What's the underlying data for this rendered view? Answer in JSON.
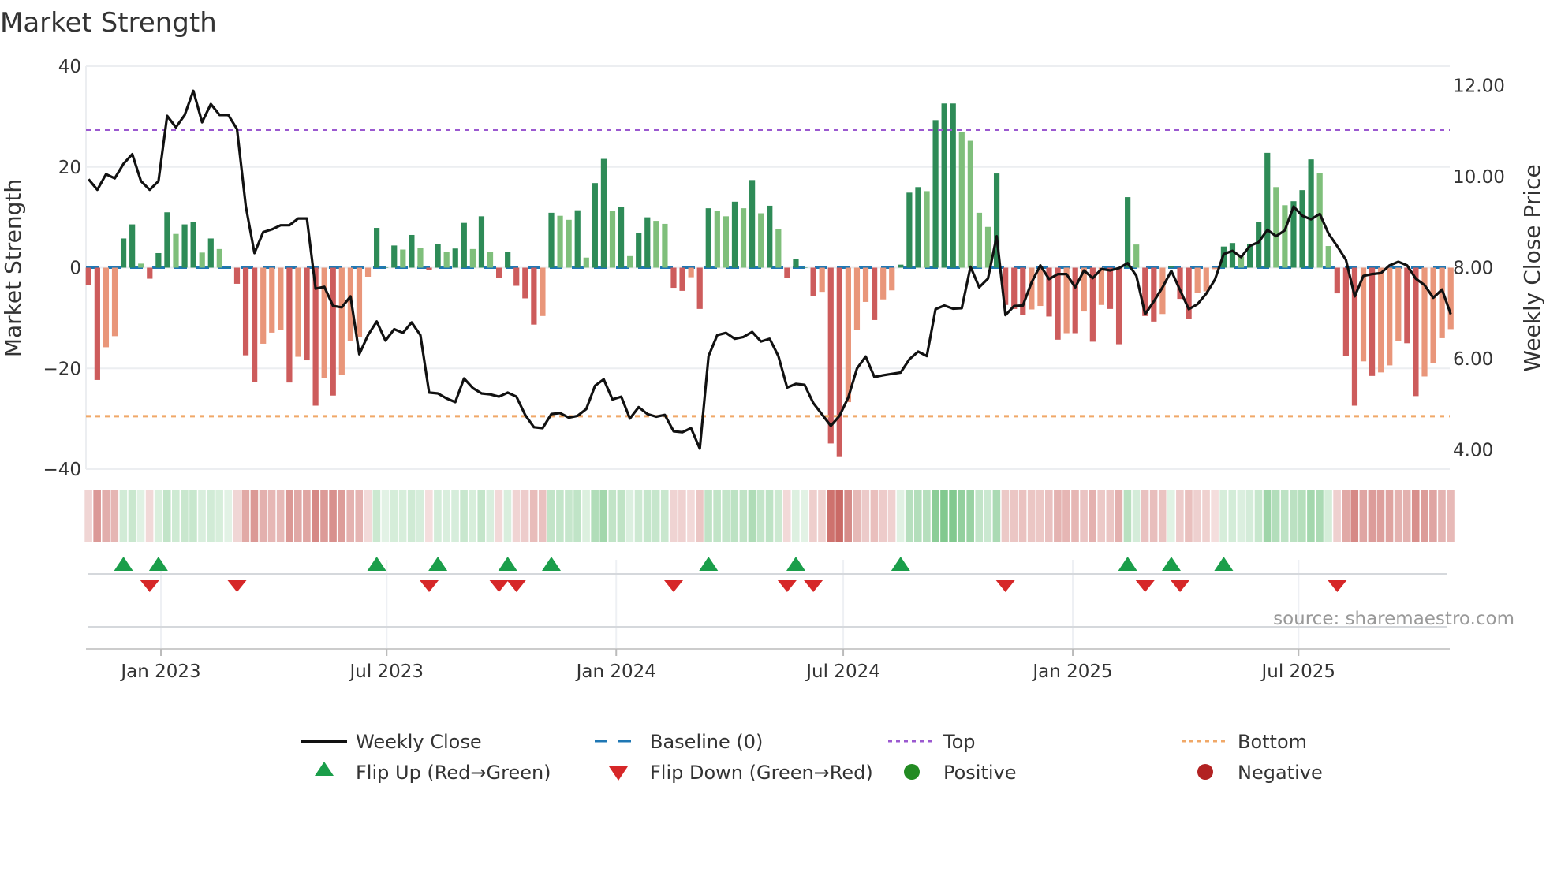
{
  "chart_data": {
    "type": "bar",
    "title": "Market Strength",
    "ylabel": "Market Strength",
    "y2label": "Weekly Close Price",
    "ylim": [
      -40,
      40
    ],
    "y2lim": [
      3.58,
      12.42
    ],
    "yticks": [
      "40",
      "20",
      "0",
      "−20",
      "−40"
    ],
    "ytick_values": [
      40,
      20,
      0,
      -20,
      -40
    ],
    "y2ticks": [
      "12.00",
      "10.00",
      "8.00",
      "6.00",
      "4.00"
    ],
    "y2tick_values": [
      12,
      10,
      8,
      6,
      4
    ],
    "xticks": [
      {
        "label": "Jan 2023",
        "date": "2023-01-01"
      },
      {
        "label": "Jul 2023",
        "date": "2023-07-01"
      },
      {
        "label": "Jan 2024",
        "date": "2024-01-01"
      },
      {
        "label": "Jul 2024",
        "date": "2024-07-01"
      },
      {
        "label": "Jan 2025",
        "date": "2025-01-01"
      },
      {
        "label": "Jul 2025",
        "date": "2025-07-01"
      }
    ],
    "first_week": "2022-11-04",
    "top_level": 27.4,
    "bottom_level": -29.5,
    "baseline": 0,
    "grid": true,
    "legend_placement": "bottom",
    "strength": [
      -3.5,
      -22.3,
      -15.8,
      -13.6,
      5.8,
      8.6,
      0.8,
      -2.2,
      2.9,
      11.0,
      6.7,
      8.6,
      9.1,
      3.0,
      5.8,
      3.7,
      0,
      -3.2,
      -17.4,
      -22.7,
      -15.1,
      -12.9,
      -12.4,
      -22.8,
      -17.7,
      -18.4,
      -27.4,
      -21.9,
      -25.4,
      -21.3,
      -14.5,
      -13.7,
      -1.8,
      7.9,
      0,
      4.4,
      3.6,
      6.5,
      3.9,
      -0.4,
      4.7,
      3.1,
      3.8,
      8.9,
      3.7,
      10.2,
      3.2,
      -2.1,
      3.1,
      -3.6,
      -6.1,
      -11.3,
      -9.6,
      10.9,
      10.3,
      9.5,
      11.4,
      2.0,
      16.8,
      21.6,
      11.3,
      12.0,
      2.3,
      6.9,
      10.0,
      9.3,
      8.7,
      -4.0,
      -4.6,
      -1.9,
      -8.2,
      11.8,
      11.2,
      10.2,
      13.1,
      11.8,
      17.4,
      10.8,
      12.3,
      7.6,
      -2.1,
      1.7,
      0,
      -5.6,
      -4.8,
      -34.9,
      -37.6,
      -26.7,
      -12.4,
      -6.8,
      -10.4,
      -6.3,
      -4.5,
      0.6,
      14.9,
      16.0,
      15.2,
      29.3,
      32.6,
      32.6,
      27.0,
      25.2,
      10.9,
      8.1,
      18.7,
      -7.4,
      -8.2,
      -9.4,
      -8.3,
      -7.6,
      -9.7,
      -14.3,
      -13.0,
      -13.0,
      -8.7,
      -14.7,
      -7.4,
      -8.2,
      -15.2,
      14.0,
      4.6,
      -9.6,
      -10.7,
      -9.2,
      0.3,
      -6.2,
      -10.2,
      -5.0,
      -4.7,
      -0.3,
      4.2,
      4.9,
      2.2,
      4.7,
      9.1,
      22.8,
      16.0,
      12.4,
      13.2,
      15.4,
      21.5,
      18.8,
      4.3,
      -5.1,
      -17.6,
      -27.4,
      -18.6,
      -21.5,
      -20.8,
      -19.4,
      -14.6,
      -15.0,
      -25.5,
      -21.6,
      -18.9,
      -14.0,
      -12.2
    ],
    "weekly_close": [
      9.94,
      9.71,
      10.05,
      9.96,
      10.28,
      10.49,
      9.9,
      9.71,
      9.9,
      11.33,
      11.08,
      11.35,
      11.88,
      11.19,
      11.59,
      11.35,
      11.35,
      11.04,
      9.35,
      8.32,
      8.78,
      8.84,
      8.93,
      8.93,
      9.08,
      9.08,
      7.54,
      7.58,
      7.16,
      7.13,
      7.37,
      6.1,
      6.52,
      6.82,
      6.4,
      6.65,
      6.57,
      6.8,
      6.52,
      5.26,
      5.24,
      5.13,
      5.05,
      5.57,
      5.36,
      5.24,
      5.22,
      5.17,
      5.26,
      5.17,
      4.77,
      4.5,
      4.48,
      4.79,
      4.81,
      4.71,
      4.75,
      4.9,
      5.41,
      5.55,
      5.11,
      5.17,
      4.69,
      4.94,
      4.79,
      4.73,
      4.77,
      4.41,
      4.39,
      4.48,
      4.03,
      6.06,
      6.52,
      6.57,
      6.44,
      6.48,
      6.59,
      6.38,
      6.44,
      6.06,
      5.37,
      5.45,
      5.43,
      5.03,
      4.78,
      4.53,
      4.75,
      5.15,
      5.79,
      6.05,
      5.6,
      5.64,
      5.67,
      5.7,
      5.99,
      6.16,
      6.06,
      7.09,
      7.17,
      7.1,
      7.11,
      8.02,
      7.57,
      7.76,
      8.69,
      6.96,
      7.16,
      7.17,
      7.68,
      8.05,
      7.75,
      7.86,
      7.86,
      7.57,
      7.94,
      7.77,
      7.97,
      7.94,
      7.99,
      8.1,
      7.82,
      6.98,
      7.26,
      7.57,
      7.93,
      7.51,
      7.09,
      7.2,
      7.43,
      7.74,
      8.3,
      8.37,
      8.23,
      8.48,
      8.56,
      8.83,
      8.69,
      8.82,
      9.34,
      9.14,
      9.06,
      9.18,
      8.75,
      8.47,
      8.17,
      7.37,
      7.82,
      7.86,
      7.88,
      8.05,
      8.13,
      8.05,
      7.76,
      7.62,
      7.34,
      7.52,
      6.98
    ],
    "legend": {
      "weekly_close": "Weekly Close",
      "baseline": "Baseline (0)",
      "top": "Top",
      "bottom": "Bottom",
      "flip_up": "Flip Up (Red→Green)",
      "flip_down": "Flip Down (Green→Red)",
      "positive": "Positive",
      "negative": "Negative"
    },
    "colors": {
      "pos_strong": "#2e8b57",
      "pos_weak": "#7fbf7b",
      "neg_strong": "#cd5c5c",
      "neg_weak": "#e9967a",
      "baseline": "#1f77b4",
      "top": "#9b59d0",
      "bottom": "#f0a868",
      "flip_up": "#1a9e4a",
      "flip_down": "#d62728",
      "positive": "#228b22",
      "negative": "#b22222",
      "close": "#111111"
    }
  },
  "source": "source: sharemaestro.com"
}
